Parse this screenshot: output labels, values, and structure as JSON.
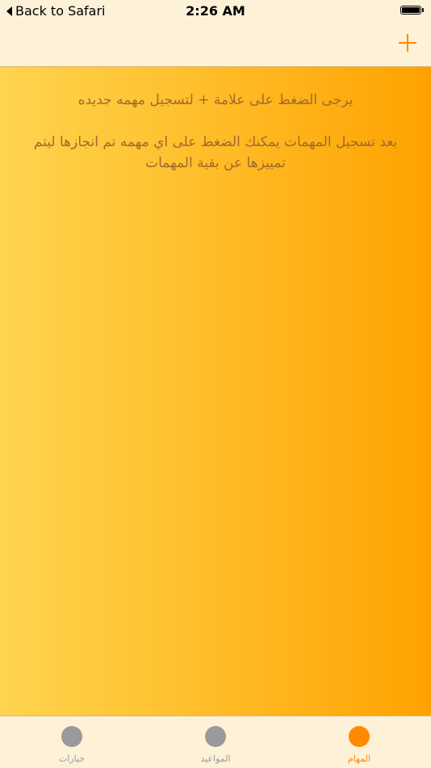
{
  "status_bar": {
    "back_label": "Back to Safari",
    "time": "2:26 AM"
  },
  "nav": {
    "add_icon": "plus-icon"
  },
  "content": {
    "instruction_1": "يرجى الضغط على علامة + لتسجيل مهمه جديده",
    "instruction_2": "بعد تسجيل المهمات يمكنك الضغط على اي مهمه تم انجازها ليتم تمييزها عن بقية المهمات"
  },
  "tabs": [
    {
      "label": "خيارات",
      "icon": "options-dot-icon",
      "active": false
    },
    {
      "label": "المواعيد",
      "icon": "appointments-dot-icon",
      "active": false
    },
    {
      "label": "المهام",
      "icon": "tasks-dot-icon",
      "active": true
    }
  ],
  "colors": {
    "accent": "#ff8a00",
    "inactive": "#9a9a9a",
    "bar_bg": "#fdf1d8",
    "text": "#a06a2c"
  }
}
